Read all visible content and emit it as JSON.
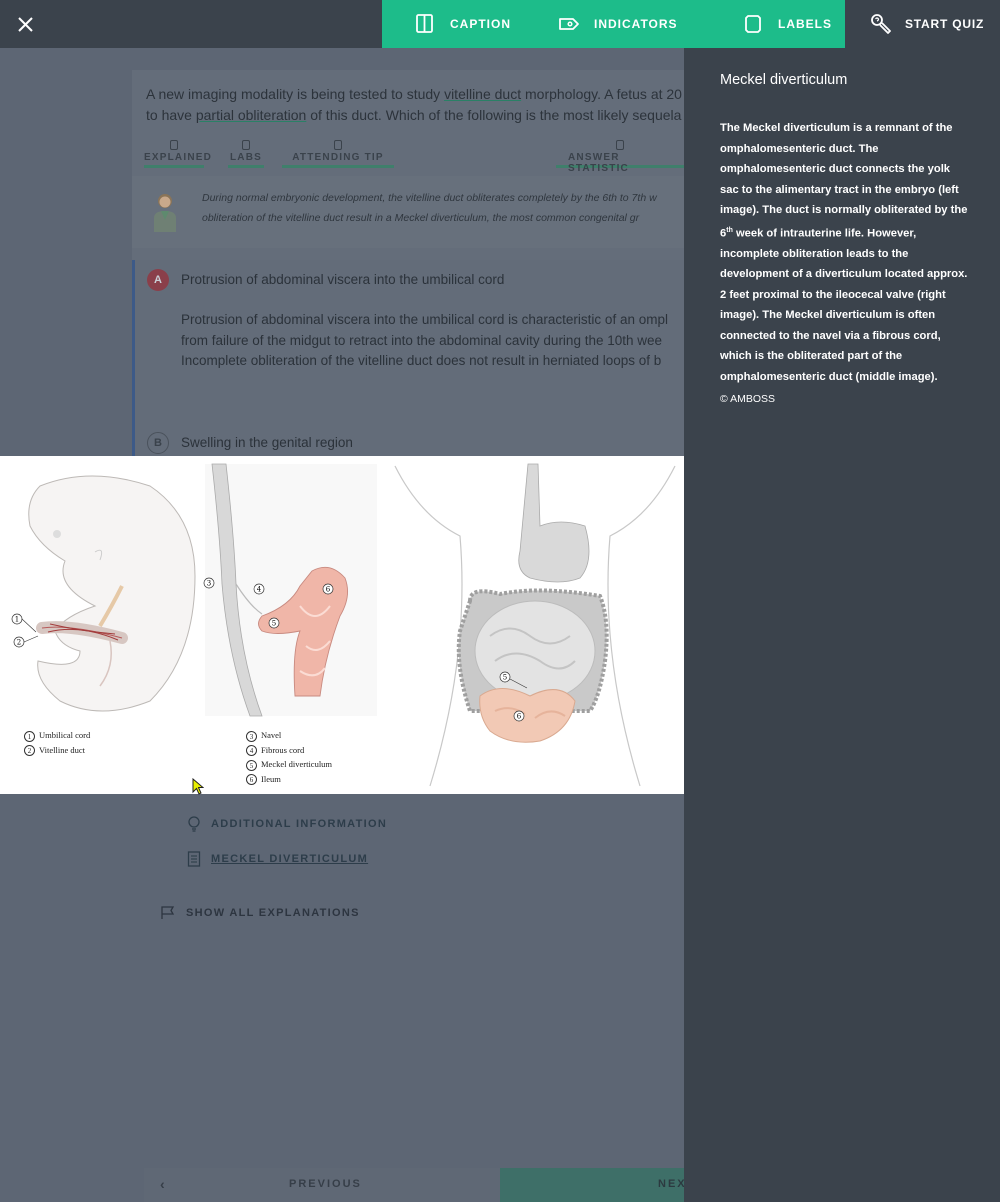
{
  "toolbar": {
    "caption_label": "CAPTION",
    "indicators_label": "INDICATORS",
    "labels_label": "LABELS",
    "start_quiz_label": "START QUIZ"
  },
  "background": {
    "question_line1_pre": "A new imaging modality is being tested to study ",
    "question_line1_link": "vitelline duct",
    "question_line1_post": " morphology. A fetus at 20",
    "question_line2_pre": "to have ",
    "question_line2_link": "partial obliteration",
    "question_line2_post": " of this duct. Which of the following is the most likely sequela",
    "tabs": {
      "explained": "EXPLAINED",
      "labs": "LABS",
      "attending": "ATTENDING TIP",
      "answer_stats": "ANSWER STATISTIC"
    },
    "hint_line1": "During normal embryonic development, the vitelline duct obliterates completely by the 6th to 7th w",
    "hint_line2": "obliteration of the vitelline duct result in a Meckel diverticulum, the most common congenital gr",
    "answer_a_letter": "A",
    "answer_a_title": "Protrusion of abdominal viscera into the umbilical cord",
    "answer_a_expl_1": "Protrusion of abdominal viscera into the umbilical cord is characteristic of an ompl",
    "answer_a_expl_2": "from failure of the midgut to retract into the abdominal cavity during the 10th wee",
    "answer_a_expl_3": "Incomplete obliteration of the vitelline duct does not result in herniated loops of b",
    "answer_b_letter": "B",
    "answer_b_title": "Swelling in the genital region",
    "additional_info": "ADDITIONAL INFORMATION",
    "meckel_link": "MECKEL DIVERTICULUM",
    "show_all": "SHOW ALL EXPLANATIONS",
    "previous": "PREVIOUS",
    "next": "NEX"
  },
  "figure": {
    "legend_left": [
      {
        "num": "1",
        "label": "Umbilical cord"
      },
      {
        "num": "2",
        "label": "Vitelline duct"
      }
    ],
    "legend_mid": [
      {
        "num": "3",
        "label": "Navel"
      },
      {
        "num": "4",
        "label": "Fibrous cord"
      },
      {
        "num": "5",
        "label": "Meckel diverticulum"
      },
      {
        "num": "6",
        "label": "Ileum"
      }
    ],
    "markers": {
      "m1": "1",
      "m2": "2",
      "m3": "3",
      "m4": "4",
      "m5": "5",
      "m6": "6",
      "r5": "5",
      "r6": "6"
    }
  },
  "caption": {
    "title": "Meckel diverticulum",
    "line1": "The Meckel diverticulum is a remnant of the",
    "line2": "omphalomesenteric duct. The",
    "line3": "omphalomesenteric duct connects the yolk",
    "line4": "sac to the alimentary tract in the embryo (left",
    "line5": "image). The duct is normally obliterated by the",
    "line6_num": "6",
    "line6_sup": "th",
    "line6_rest": " week of intrauterine life. However,",
    "line7": "incomplete obliteration leads to the",
    "line8": "development of a diverticulum located approx.",
    "line9": "2 feet proximal to the ileocecal valve (right",
    "line10": "image). The Meckel diverticulum is often",
    "line11": "connected to the navel via a fibrous cord,",
    "line12": "which is the obliterated part of the",
    "line13": "omphalomesenteric duct (middle image).",
    "copyright": "© AMBOSS"
  },
  "colors": {
    "accent": "#1dbc8a",
    "panel_dark": "#3b434c",
    "overlay": "#5d6674"
  },
  "icons": [
    "close-icon",
    "caption-icon",
    "indicators-icon",
    "labels-icon",
    "quiz-icon",
    "lightbulb-icon",
    "document-icon",
    "flag-icon"
  ]
}
